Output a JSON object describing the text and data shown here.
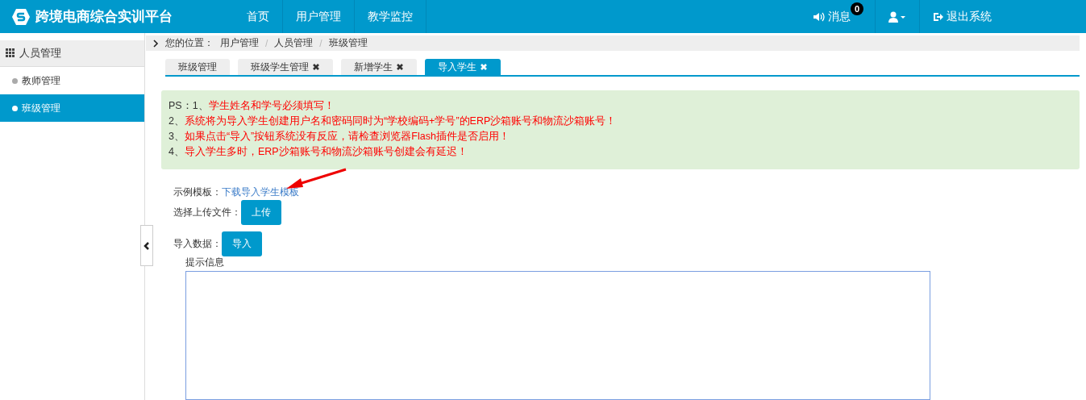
{
  "header": {
    "brand": "跨境电商综合实训平台",
    "nav": [
      {
        "label": "首页",
        "selected": false
      },
      {
        "label": "用户管理",
        "selected": false
      },
      {
        "label": "教学监控",
        "selected": false
      }
    ],
    "messages": {
      "label": "消息",
      "count": "0"
    },
    "logout": "退出系统"
  },
  "sidebar": {
    "section": "人员管理",
    "items": [
      {
        "label": "教师管理",
        "selected": false
      },
      {
        "label": "班级管理",
        "selected": true
      }
    ]
  },
  "breadcrumb": {
    "prefix": "您的位置：",
    "separator": "/",
    "items": [
      "用户管理",
      "人员管理",
      "班级管理"
    ]
  },
  "tabs": [
    {
      "label": "班级管理",
      "closable": false,
      "selected": false
    },
    {
      "label": "班级学生管理",
      "closable": true,
      "selected": false
    },
    {
      "label": "新增学生",
      "closable": true,
      "selected": false
    },
    {
      "label": "导入学生",
      "closable": true,
      "selected": true
    }
  ],
  "notice": [
    {
      "prefix": "PS：1、",
      "text": "学生姓名和学号必须填写！"
    },
    {
      "prefix": "2、",
      "text": "系统将为导入学生创建用户名和密码同时为“学校编码+学号”的ERP沙箱账号和物流沙箱账号！"
    },
    {
      "prefix": "3、",
      "text": "如果点击“导入”按钮系统没有反应，请检查浏览器Flash插件是否启用！"
    },
    {
      "prefix": "4、",
      "text": "导入学生多时，ERP沙箱账号和物流沙箱账号创建会有延迟！"
    }
  ],
  "form": {
    "template_label": "示例模板：",
    "template_link": "下载导入学生模板",
    "upload_label": "选择上传文件：",
    "upload_button": "上传",
    "import_label": "导入数据：",
    "import_button": "导入",
    "message_label": "提示信息"
  }
}
